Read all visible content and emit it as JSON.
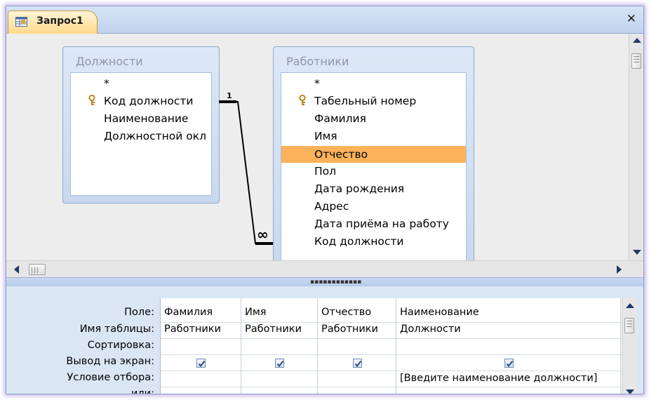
{
  "tab": {
    "title": "Запрос1",
    "icon": "query-design-icon",
    "close": "✕"
  },
  "tables": [
    {
      "title": "Должности",
      "fields": [
        {
          "label": "*",
          "key": false
        },
        {
          "label": "Код должности",
          "key": true
        },
        {
          "label": "Наименование",
          "key": false
        },
        {
          "label": "Должностной окл",
          "key": false
        }
      ]
    },
    {
      "title": "Работники",
      "fields": [
        {
          "label": "*",
          "key": false
        },
        {
          "label": "Табельный номер",
          "key": true
        },
        {
          "label": "Фамилия",
          "key": false
        },
        {
          "label": "Имя",
          "key": false
        },
        {
          "label": "Отчество",
          "key": false,
          "selected": true
        },
        {
          "label": "Пол",
          "key": false
        },
        {
          "label": "Дата рождения",
          "key": false
        },
        {
          "label": "Адрес",
          "key": false
        },
        {
          "label": "Дата приёма на работу",
          "key": false
        },
        {
          "label": "Код должности",
          "key": false
        }
      ]
    }
  ],
  "relationship": {
    "one_side": "1",
    "many_side": "∞"
  },
  "grid": {
    "row_labels": [
      "Поле:",
      "Имя таблицы:",
      "Сортировка:",
      "Вывод на экран:",
      "Условие отбора:",
      "или:"
    ],
    "columns": [
      {
        "field": "Фамилия",
        "table": "Работники",
        "sort": "",
        "show": true,
        "criteria": ""
      },
      {
        "field": "Имя",
        "table": "Работники",
        "sort": "",
        "show": true,
        "criteria": ""
      },
      {
        "field": "Отчество",
        "table": "Работники",
        "sort": "",
        "show": true,
        "criteria": ""
      },
      {
        "field": "Наименование",
        "table": "Должности",
        "sort": "",
        "show": true,
        "criteria": "[Введите наименование должности]"
      }
    ]
  },
  "colors": {
    "selection": "#fbb25a",
    "tab": "#ffd98a",
    "frame": "#bcd0ea"
  }
}
